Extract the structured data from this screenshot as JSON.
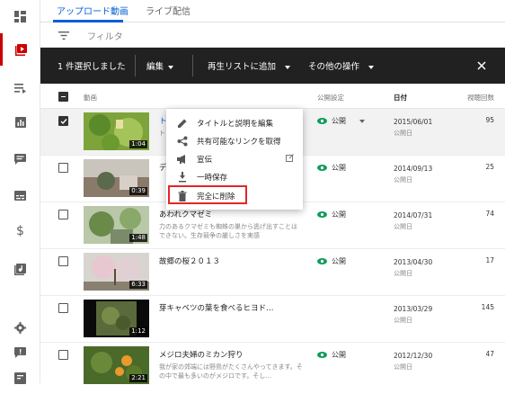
{
  "tabs": [
    {
      "label": "アップロード動画",
      "active": true
    },
    {
      "label": "ライブ配信",
      "active": false
    }
  ],
  "filter": {
    "label": "フィルタ"
  },
  "action_bar": {
    "selected_text": "1 件選択しました",
    "edit": "編集",
    "add_to_playlist": "再生リストに追加",
    "more_actions": "その他の操作"
  },
  "headers": {
    "video": "動画",
    "visibility": "公開設定",
    "date": "日付",
    "views": "視聴回数"
  },
  "rows": [
    {
      "title": "ト",
      "desc": "ト",
      "duration": "1:04",
      "visibility": "公開",
      "date": "2015/06/01",
      "date_sub": "公開日",
      "views": "95",
      "checked": true
    },
    {
      "title": "デ",
      "desc": "",
      "duration": "0:39",
      "visibility": "公開",
      "date": "2014/09/13",
      "date_sub": "公開日",
      "views": "25",
      "checked": false
    },
    {
      "title": "あわれクマゼミ",
      "desc": "力のあるクマゼミも蜘蛛の巣から逃げ出すことはできない。生存競争の厳しさを実感",
      "duration": "1:48",
      "visibility": "公開",
      "date": "2014/07/31",
      "date_sub": "公開日",
      "views": "74",
      "checked": false
    },
    {
      "title": "故郷の桜２０１３",
      "desc": "",
      "duration": "6:33",
      "visibility": "公開",
      "date": "2013/04/30",
      "date_sub": "公開日",
      "views": "17",
      "checked": false
    },
    {
      "title": "芽キャベツの葉を食べるヒヨド…",
      "desc": "",
      "duration": "1:12",
      "visibility": "公開",
      "date": "2013/03/29",
      "date_sub": "公開日",
      "views": "145",
      "checked": false
    },
    {
      "title": "メジロ夫婦のミカン狩り",
      "desc": "我が家の郊端には野鳥がたくさんやってきます。その中で最も多いのがメジロです。そし…",
      "duration": "2:21",
      "visibility": "公開",
      "date": "2012/12/30",
      "date_sub": "公開日",
      "views": "47",
      "checked": false
    }
  ],
  "context_menu": [
    {
      "label": "タイトルと説明を編集",
      "icon": "pencil-icon"
    },
    {
      "label": "共有可能なリンクを取得",
      "icon": "share-icon"
    },
    {
      "label": "宣伝",
      "icon": "megaphone-icon"
    },
    {
      "label": "一時保存",
      "icon": "download-icon"
    },
    {
      "label": "完全に削除",
      "icon": "trash-icon"
    }
  ],
  "colors": {
    "accent": "#065fd4",
    "brand_red": "#cc0000",
    "public_green": "#0f9d58",
    "highlight": "#e3262a"
  }
}
